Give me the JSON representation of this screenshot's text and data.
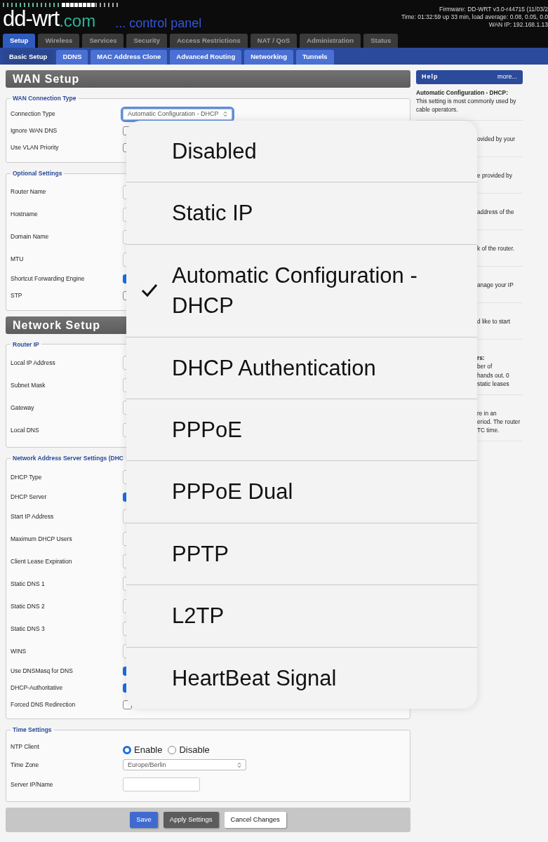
{
  "header": {
    "logo": "dd-wrt",
    "logo_domain": ".com",
    "subtitle": "... control panel",
    "info": [
      "Firmware: DD-WRT v3.0-r44715 (11/03/2",
      "Time: 01:32:59 up 33 min, load average: 0.08, 0.05, 0.0",
      "WAN IP: 192.168.1.13"
    ]
  },
  "tabs": [
    {
      "label": "Setup",
      "selected": true
    },
    {
      "label": "Wireless",
      "selected": false
    },
    {
      "label": "Services",
      "selected": false
    },
    {
      "label": "Security",
      "selected": false
    },
    {
      "label": "Access Restrictions",
      "selected": false
    },
    {
      "label": "NAT / QoS",
      "selected": false
    },
    {
      "label": "Administration",
      "selected": false
    },
    {
      "label": "Status",
      "selected": false
    }
  ],
  "subtabs": [
    {
      "label": "Basic Setup",
      "selected": true
    },
    {
      "label": "DDNS",
      "selected": false
    },
    {
      "label": "MAC Address Clone",
      "selected": false
    },
    {
      "label": "Advanced Routing",
      "selected": false
    },
    {
      "label": "Networking",
      "selected": false
    },
    {
      "label": "Tunnels",
      "selected": false
    }
  ],
  "sections": [
    {
      "title": "WAN Setup",
      "fieldsets": [
        {
          "legend": "WAN Connection Type",
          "rows": [
            {
              "label": "Connection Type",
              "kind": "select",
              "value": "Automatic Configuration - DHCP",
              "focused": true
            },
            {
              "label": "Ignore WAN DNS",
              "kind": "checkbox",
              "checked": false
            },
            {
              "label": "Use VLAN Priority",
              "kind": "checkbox",
              "checked": false
            }
          ]
        },
        {
          "legend": "Optional Settings",
          "rows": [
            {
              "label": "Router Name",
              "kind": "text"
            },
            {
              "label": "Hostname",
              "kind": "text"
            },
            {
              "label": "Domain Name",
              "kind": "text"
            },
            {
              "label": "MTU",
              "kind": "text"
            },
            {
              "label": "Shortcut Forwarding Engine",
              "kind": "checkbox",
              "checked": true
            },
            {
              "label": "STP",
              "kind": "checkbox",
              "checked": false
            }
          ]
        }
      ]
    },
    {
      "title": "Network Setup",
      "fieldsets": [
        {
          "legend": "Router IP",
          "rows": [
            {
              "label": "Local IP Address",
              "kind": "text"
            },
            {
              "label": "Subnet Mask",
              "kind": "text"
            },
            {
              "label": "Gateway",
              "kind": "text"
            },
            {
              "label": "Local DNS",
              "kind": "text"
            }
          ]
        },
        {
          "legend": "Network Address Server Settings (DHC",
          "rows": [
            {
              "label": "DHCP Type",
              "kind": "text"
            },
            {
              "label": "DHCP Server",
              "kind": "checkbox",
              "checked": true
            },
            {
              "label": "Start IP Address",
              "kind": "text"
            },
            {
              "label": "Maximum DHCP Users",
              "kind": "text"
            },
            {
              "label": "Client Lease Expiration",
              "kind": "text"
            },
            {
              "label": "Static DNS 1",
              "kind": "text"
            },
            {
              "label": "Static DNS 2",
              "kind": "text"
            },
            {
              "label": "Static DNS 3",
              "kind": "text"
            },
            {
              "label": "WINS",
              "kind": "text"
            },
            {
              "label": "Use DNSMasq for DNS",
              "kind": "checkbox",
              "checked": true
            },
            {
              "label": "DHCP-Authoritative",
              "kind": "checkbox",
              "checked": true
            },
            {
              "label": "Forced DNS Redirection",
              "kind": "checkbox",
              "checked": false
            }
          ]
        },
        {
          "legend": "Time Settings",
          "rows": [
            {
              "label": "NTP Client",
              "kind": "radios",
              "options": [
                {
                  "label": "Enable",
                  "selected": true
                },
                {
                  "label": "Disable",
                  "selected": false
                }
              ]
            },
            {
              "label": "Time Zone",
              "kind": "select",
              "value": "Europe/Berlin",
              "focused": false
            },
            {
              "label": "Server IP/Name",
              "kind": "text"
            }
          ]
        }
      ]
    }
  ],
  "buttons": [
    {
      "label": "Save",
      "kind": "primary"
    },
    {
      "label": "Apply Settings",
      "kind": "secondary"
    },
    {
      "label": "Cancel Changes",
      "kind": "light"
    }
  ],
  "help": {
    "title": "Help",
    "more": "more...",
    "items": [
      {
        "heading": "Automatic Configuration - DHCP:",
        "lines": [
          "This setting is most commonly used by cable operators."
        ],
        "partial": false
      },
      {
        "lines": [
          "ovided by your"
        ],
        "partial": true
      },
      {
        "lines": [
          "e provided by"
        ],
        "partial": true
      },
      {
        "lines": [
          "address of the"
        ],
        "partial": true
      },
      {
        "lines": [
          "k of the router."
        ],
        "partial": true
      },
      {
        "lines": [
          "anage your IP"
        ],
        "partial": true
      },
      {
        "lines": [
          "d like to start"
        ],
        "partial": true
      },
      {
        "heading": "rs:",
        "lines": [
          "ber of",
          "hands out. 0",
          "static leases"
        ],
        "partial": true
      },
      {
        "lines": [
          "re in an",
          "eriod. The router",
          "TC time."
        ],
        "partial": true
      }
    ]
  },
  "picker": {
    "options": [
      {
        "label": "Disabled",
        "selected": false
      },
      {
        "label": "Static IP",
        "selected": false
      },
      {
        "label": "Automatic Configuration - DHCP",
        "selected": true
      },
      {
        "label": "DHCP Authentication",
        "selected": false
      },
      {
        "label": "PPPoE",
        "selected": false
      },
      {
        "label": "PPPoE Dual",
        "selected": false
      },
      {
        "label": "PPTP",
        "selected": false
      },
      {
        "label": "L2TP",
        "selected": false
      },
      {
        "label": "HeartBeat Signal",
        "selected": false
      }
    ]
  }
}
